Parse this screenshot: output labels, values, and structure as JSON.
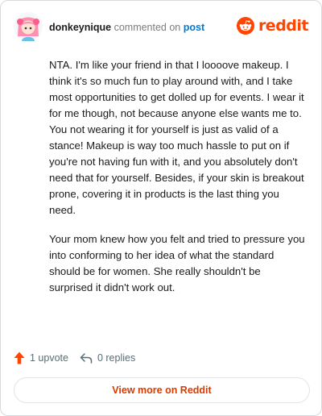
{
  "comment": {
    "username": "donkeynique",
    "action_text": "commented on",
    "post_link": "post",
    "paragraphs": [
      "NTA. I'm like your friend in that I loooove makeup. I think it's so much fun to play around with, and I take most opportunities to get dolled up for events. I wear it for me though, not because anyone else wants me to. You not wearing it for yourself is just as valid of a stance! Makeup is way too much hassle to put on if you're not having fun with it, and you absolutely don't need that for yourself. Besides, if your skin is breakout prone, covering it in products is the last thing you need.",
      "Your mom knew how you felt and tried to pressure you into conforming to her idea of what the standard should be for women. She really shouldn't be surprised it didn't work out."
    ],
    "upvotes_label": "1 upvote",
    "replies_label": "0 replies"
  },
  "brand": {
    "wordmark": "reddit",
    "icon": "reddit-snoo-icon"
  },
  "footer": {
    "view_more_label": "View more on Reddit"
  },
  "colors": {
    "brand_orange": "#ff4500",
    "link_blue": "#0079d3",
    "upvote_orange": "#ff4500",
    "view_more_text": "#d93a00",
    "avatar_pink": "#ff8fb1"
  }
}
